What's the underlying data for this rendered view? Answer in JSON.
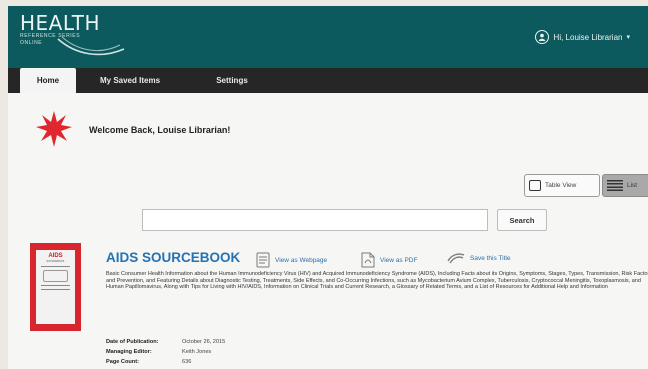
{
  "header": {
    "logo": {
      "word": "HEALTH",
      "line1": "REFERENCE SERIES",
      "line2": "ONLINE"
    },
    "user_label": "Hi, Louise Librarian",
    "user_caret": "▾"
  },
  "nav": {
    "tabs": [
      {
        "label": "Home"
      },
      {
        "label": "My Saved Items"
      },
      {
        "label": "Settings"
      }
    ]
  },
  "welcome": {
    "text": "Welcome Back, Louise Librarian!"
  },
  "view_toggle": {
    "table_label": "Table View",
    "list_label": "List"
  },
  "search": {
    "value": "",
    "placeholder": "",
    "button_label": "Search"
  },
  "book": {
    "cover_title": "AIDS",
    "cover_subtitle": "SOURCEBOOK",
    "title": "AIDS SOURCEBOOK",
    "actions": {
      "webpage": "View as Webpage",
      "pdf": "View as PDF",
      "save": "Save this Title"
    },
    "description": "Basic Consumer Health Information about the Human Immunodeficiency Virus (HIV) and Acquired Immunodeficiency Syndrome (AIDS), Including Facts about its Origins, Symptoms, Stages, Types, Transmission, Risk Factors, and Prevention, and Featuring Details about Diagnostic Testing, Treatments, Side Effects, and Co-Occurring Infections, such as Mycobacterium Avium Complex, Tuberculosis, Cryptococcal Meningitis, Toxoplasmosis, and Human Papillomavirus, Along with Tips for Living with HIV/AIDS, Information on Clinical Trials and Current Research, a Glossary of Related Terms, and a List of Resources for Additional Help and Information",
    "meta": {
      "date_label": "Date of Publication:",
      "date_value": "October 26, 2015",
      "editor_label": "Managing Editor:",
      "editor_value": "Keith Jones",
      "pages_label": "Page Count:",
      "pages_value": "636"
    }
  },
  "colors": {
    "header_bg": "#0d5a5e",
    "nav_bg": "#262626",
    "link_blue": "#2372b4",
    "star_red": "#e0262e"
  }
}
